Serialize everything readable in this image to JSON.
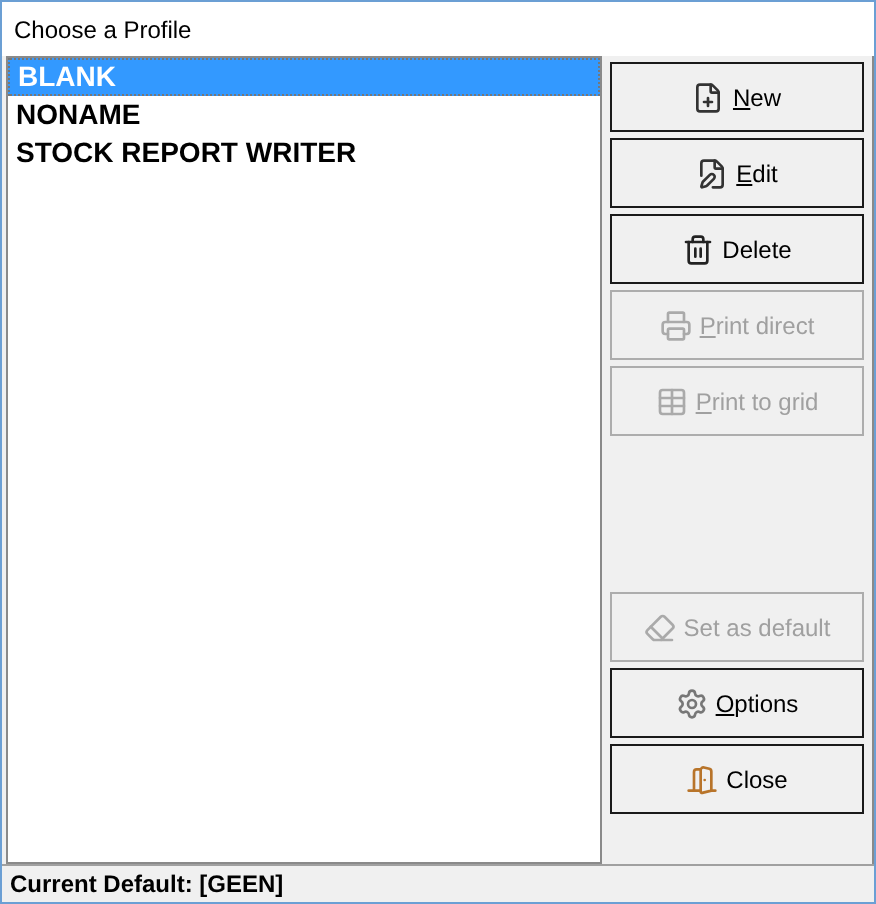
{
  "window": {
    "title": "Choose a Profile"
  },
  "profiles": [
    {
      "name": "BLANK",
      "selected": true
    },
    {
      "name": "NONAME",
      "selected": false
    },
    {
      "name": "STOCK REPORT WRITER",
      "selected": false
    }
  ],
  "buttons_top": [
    {
      "accel": "N",
      "after": "ew",
      "disabled": false
    },
    {
      "accel": "E",
      "after": "dit",
      "disabled": false
    },
    {
      "before": "Delete",
      "disabled": false
    },
    {
      "accel": "P",
      "after": "rint direct",
      "disabled": true
    },
    {
      "accel": "P",
      "after": "rint to grid",
      "disabled": true
    }
  ],
  "buttons_bottom": [
    {
      "before": "Set as default",
      "disabled": true
    },
    {
      "accel": "O",
      "after": "ptions",
      "disabled": false
    },
    {
      "before": "Close",
      "disabled": false
    }
  ],
  "status_bar": "Current Default: [GEEN]"
}
